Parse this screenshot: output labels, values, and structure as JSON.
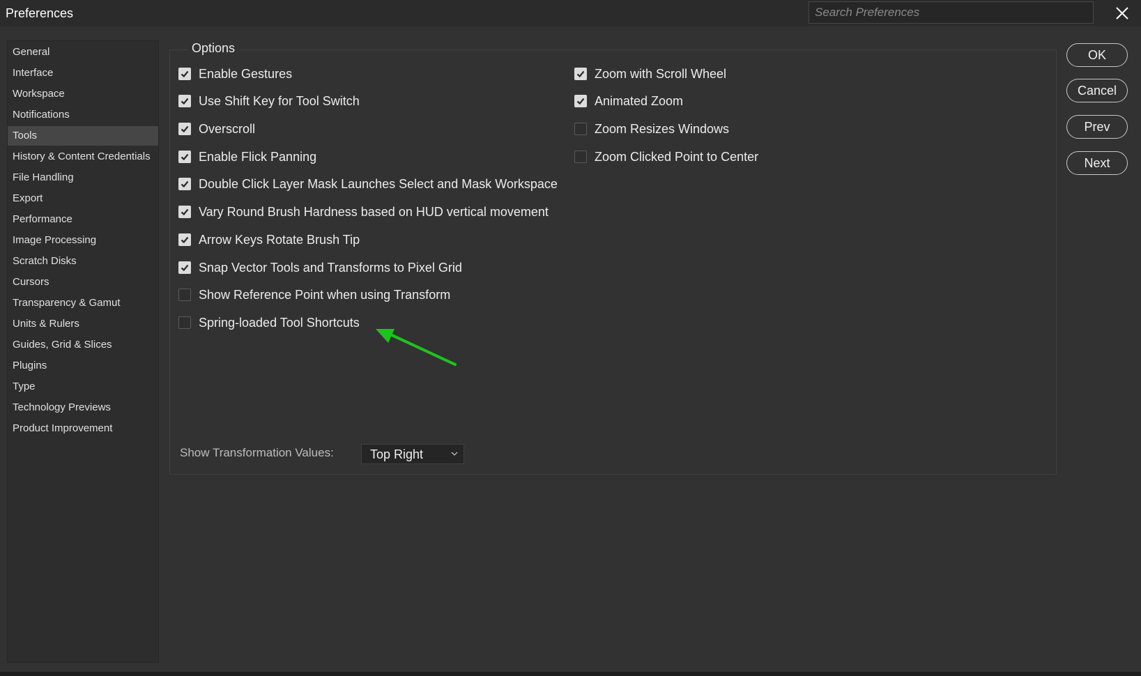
{
  "window": {
    "title": "Preferences"
  },
  "search": {
    "placeholder": "Search Preferences"
  },
  "sidebar": {
    "items": [
      {
        "label": "General"
      },
      {
        "label": "Interface"
      },
      {
        "label": "Workspace"
      },
      {
        "label": "Notifications"
      },
      {
        "label": "Tools",
        "selected": true
      },
      {
        "label": "History & Content Credentials"
      },
      {
        "label": "File Handling"
      },
      {
        "label": "Export"
      },
      {
        "label": "Performance"
      },
      {
        "label": "Image Processing"
      },
      {
        "label": "Scratch Disks"
      },
      {
        "label": "Cursors"
      },
      {
        "label": "Transparency & Gamut"
      },
      {
        "label": "Units & Rulers"
      },
      {
        "label": "Guides, Grid & Slices"
      },
      {
        "label": "Plugins"
      },
      {
        "label": "Type"
      },
      {
        "label": "Technology Previews"
      },
      {
        "label": "Product Improvement"
      }
    ]
  },
  "options": {
    "legend": "Options",
    "left": [
      {
        "label": "Enable Gestures",
        "checked": true
      },
      {
        "label": "Use Shift Key for Tool Switch",
        "checked": true
      },
      {
        "label": "Overscroll",
        "checked": true
      },
      {
        "label": "Enable Flick Panning",
        "checked": true
      },
      {
        "label": "Double Click Layer Mask Launches Select and Mask Workspace",
        "checked": true
      },
      {
        "label": "Vary Round Brush Hardness based on HUD vertical movement",
        "checked": true
      },
      {
        "label": "Arrow Keys Rotate Brush Tip",
        "checked": true
      },
      {
        "label": "Snap Vector Tools and Transforms to Pixel Grid",
        "checked": true
      },
      {
        "label": "Show Reference Point when using Transform",
        "checked": false
      },
      {
        "label": "Spring-loaded Tool Shortcuts",
        "checked": false
      }
    ],
    "right": [
      {
        "label": "Zoom with Scroll Wheel",
        "checked": true
      },
      {
        "label": "Animated Zoom",
        "checked": true
      },
      {
        "label": "Zoom Resizes Windows",
        "checked": false
      },
      {
        "label": "Zoom Clicked Point to Center",
        "checked": false
      }
    ]
  },
  "transformation": {
    "label": "Show Transformation Values:",
    "value": "Top Right"
  },
  "buttons": {
    "ok": "OK",
    "cancel": "Cancel",
    "prev": "Prev",
    "next": "Next"
  },
  "colors": {
    "dialog_bg": "#323232",
    "titlebar_bg": "#2b2b2b",
    "selected_item_bg": "#464646",
    "annotation_arrow": "#1ec41e"
  },
  "icons": {
    "close": "close-icon",
    "checkbox_check": "check-icon",
    "dropdown": "chevron-down-icon",
    "annotation": "arrow-annotation-icon"
  }
}
